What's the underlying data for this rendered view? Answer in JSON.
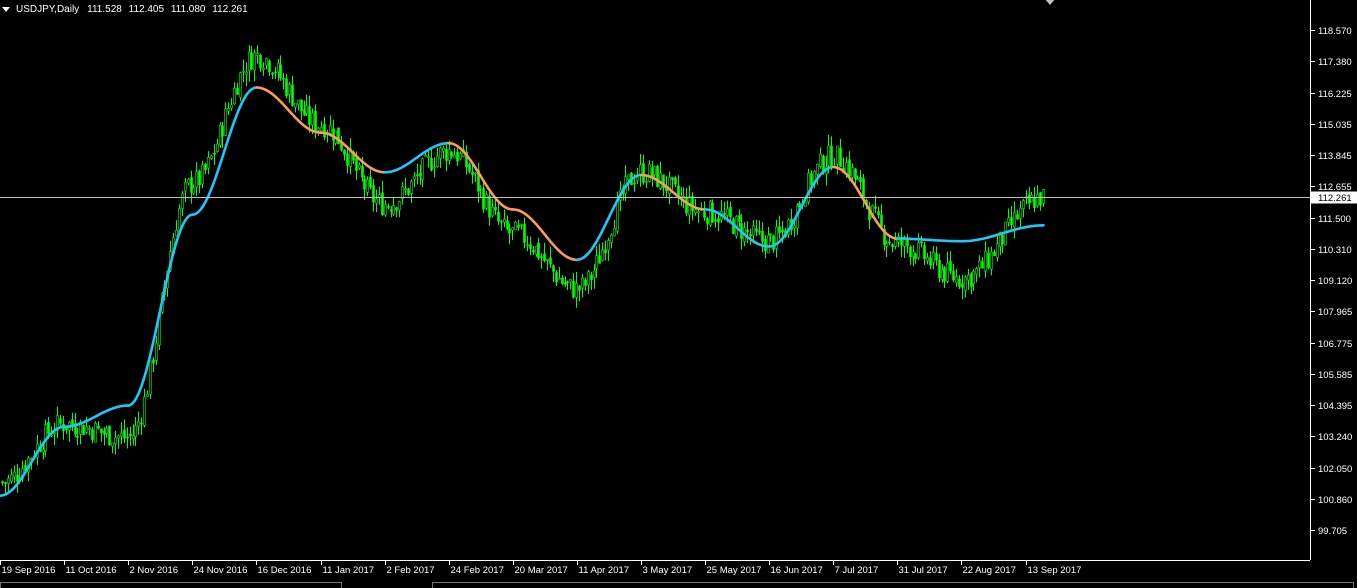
{
  "header": {
    "symbol": "USDJPY,Daily",
    "open": "111.528",
    "high": "112.405",
    "low": "111.080",
    "close": "112.261"
  },
  "colors": {
    "background": "#000000",
    "candle": "#00ff00",
    "axis": "#ffffff",
    "text": "#ffffff",
    "price_line": "#c0c0c0",
    "ma_up": "#1ec8ff",
    "ma_down": "#ff9a57"
  },
  "chart_data": {
    "type": "line",
    "price_ticks": [
      "118.570",
      "117.380",
      "116.225",
      "115.035",
      "113.845",
      "112.655",
      "111.500",
      "110.310",
      "109.120",
      "107.965",
      "106.775",
      "105.585",
      "104.395",
      "103.240",
      "102.050",
      "100.860",
      "99.705"
    ],
    "date_ticks": [
      "19 Sep 2016",
      "11 Oct 2016",
      "2 Nov 2016",
      "24 Nov 2016",
      "16 Dec 2016",
      "11 Jan 2017",
      "2 Feb 2017",
      "24 Feb 2017",
      "20 Mar 2017",
      "11 Apr 2017",
      "3 May 2017",
      "25 May 2017",
      "16 Jun 2017",
      "7 Jul 2017",
      "31 Jul 2017",
      "22 Aug 2017",
      "13 Sep 2017"
    ],
    "current_price": "112.261",
    "ylim": [
      99.705,
      118.57
    ],
    "grid": false,
    "price_series": {
      "name": "",
      "x": [
        "19 Sep 2016",
        "11 Oct 2016",
        "2 Nov 2016",
        "24 Nov 2016",
        "16 Dec 2016",
        "11 Jan 2017",
        "2 Feb 2017",
        "24 Feb 2017",
        "20 Mar 2017",
        "11 Apr 2017",
        "3 May 2017",
        "25 May 2017",
        "16 Jun 2017",
        "7 Jul 2017",
        "31 Jul 2017",
        "22 Aug 2017",
        "13 Sep 2017"
      ],
      "values": [
        101.5,
        103.7,
        103.2,
        112.8,
        117.6,
        115.0,
        112.0,
        114.0,
        110.9,
        108.8,
        113.2,
        111.7,
        110.6,
        113.8,
        110.5,
        109.2,
        112.26
      ]
    },
    "ma_series": {
      "name": "",
      "x": [
        "19 Sep 2016",
        "11 Oct 2016",
        "2 Nov 2016",
        "24 Nov 2016",
        "16 Dec 2016",
        "11 Jan 2017",
        "2 Feb 2017",
        "24 Feb 2017",
        "20 Mar 2017",
        "11 Apr 2017",
        "3 May 2017",
        "25 May 2017",
        "16 Jun 2017",
        "7 Jul 2017",
        "31 Jul 2017",
        "22 Aug 2017",
        "13 Sep 2017"
      ],
      "values": [
        101.0,
        103.6,
        104.4,
        111.6,
        116.4,
        114.7,
        113.2,
        114.3,
        111.8,
        109.9,
        113.1,
        111.8,
        110.4,
        113.4,
        110.7,
        110.6,
        111.2
      ],
      "direction": [
        "down",
        "up",
        "up",
        "up",
        "flat",
        "down",
        "down",
        "up",
        "down",
        "down",
        "up",
        "down",
        "flat",
        "up",
        "down",
        "flat",
        "up"
      ]
    }
  }
}
